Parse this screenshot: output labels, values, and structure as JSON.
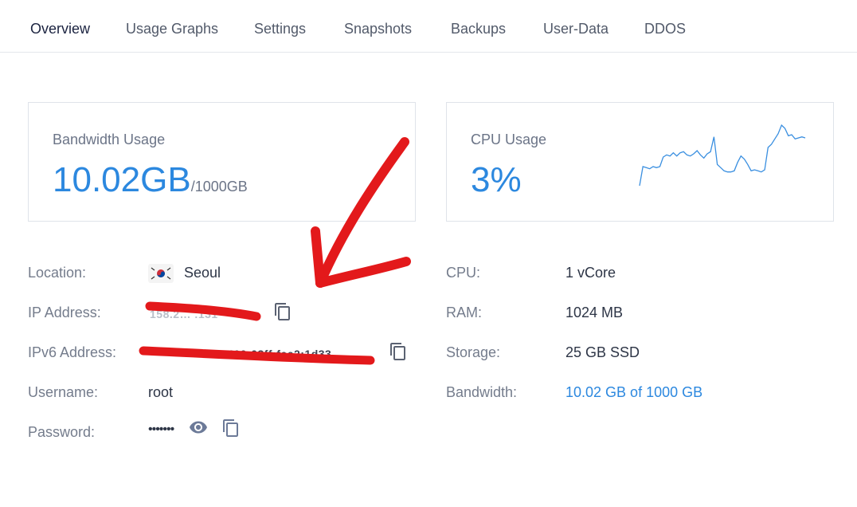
{
  "tabs": [
    "Overview",
    "Usage Graphs",
    "Settings",
    "Snapshots",
    "Backups",
    "User-Data",
    "DDOS"
  ],
  "bandwidth_card": {
    "label": "Bandwidth Usage",
    "value": "10.02GB",
    "limit": "/1000GB"
  },
  "cpu_card": {
    "label": "CPU Usage",
    "value": "3%",
    "sparkline": [
      2,
      20,
      19,
      18,
      20,
      19,
      20,
      29,
      31,
      30,
      33,
      30,
      33,
      34,
      31,
      30,
      32,
      35,
      31,
      28,
      32,
      34,
      48,
      22,
      19,
      16,
      15,
      15,
      16,
      24,
      30,
      27,
      22,
      16,
      17,
      16,
      15,
      17,
      38,
      41,
      46,
      51,
      59,
      56,
      49,
      50,
      46,
      47,
      48,
      47
    ]
  },
  "details_left": {
    "location": {
      "label": "Location:",
      "value": "Seoul"
    },
    "ip": {
      "label": "IP Address:",
      "value": "158.2… .131"
    },
    "ipv6": {
      "label": "IPv6 Address:",
      "value": "… 5400:03ff:fee2:1d33"
    },
    "username": {
      "label": "Username:",
      "value": "root"
    },
    "password": {
      "label": "Password:",
      "value": "•••••••"
    }
  },
  "details_right": {
    "cpu": {
      "label": "CPU:",
      "value": "1 vCore"
    },
    "ram": {
      "label": "RAM:",
      "value": "1024 MB"
    },
    "storage": {
      "label": "Storage:",
      "value": "25 GB SSD"
    },
    "bandwidth": {
      "label": "Bandwidth:",
      "value": "10.02 GB of 1000 GB"
    }
  },
  "colors": {
    "accent": "#2c88df",
    "annotation": "#e3191b"
  },
  "icons": {
    "copy": "copy-icon",
    "eye": "eye-icon",
    "flag": "south-korea-flag-icon"
  }
}
